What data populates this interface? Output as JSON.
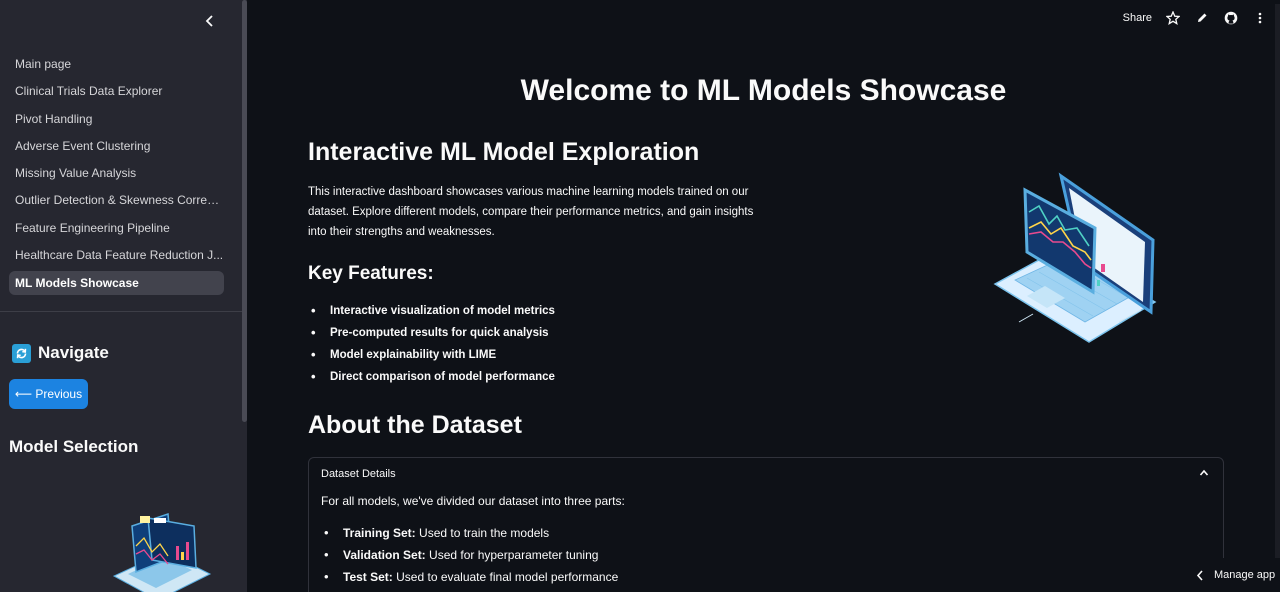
{
  "sidebar": {
    "collapse_icon": "chevron-left-icon",
    "items": [
      {
        "label": "Main page"
      },
      {
        "label": "Clinical Trials Data Explorer"
      },
      {
        "label": "Pivot Handling"
      },
      {
        "label": "Adverse Event Clustering"
      },
      {
        "label": "Missing Value Analysis"
      },
      {
        "label": "Outlier Detection & Skewness Correct..."
      },
      {
        "label": "Feature Engineering Pipeline"
      },
      {
        "label": "Healthcare Data Feature Reduction J..."
      },
      {
        "label": "ML Models Showcase",
        "active": true
      }
    ],
    "navigate_heading": "Navigate",
    "navigate_icon": "refresh-icon",
    "previous_button": "⟵ Previous",
    "model_selection_heading": "Model Selection"
  },
  "topbar": {
    "share_label": "Share",
    "icons": [
      "star-icon",
      "pencil-icon",
      "github-icon",
      "kebab-menu-icon"
    ]
  },
  "main": {
    "title": "Welcome to ML Models Showcase",
    "section1_heading": "Interactive ML Model Exploration",
    "intro_text": "This interactive dashboard showcases various machine learning models trained on our dataset. Explore different models, compare their performance metrics, and gain insights into their strengths and weaknesses.",
    "features_heading": "Key Features:",
    "features": [
      "Interactive visualization of model metrics",
      "Pre-computed results for quick analysis",
      "Model explainability with LIME",
      "Direct comparison of model performance"
    ],
    "dataset_heading": "About the Dataset",
    "expander": {
      "label": "Dataset Details",
      "intro": "For all models, we've divided our dataset into three parts:",
      "items": [
        {
          "term": "Training Set:",
          "desc": " Used to train the models"
        },
        {
          "term": "Validation Set:",
          "desc": " Used for hyperparameter tuning"
        },
        {
          "term": "Test Set:",
          "desc": " Used to evaluate final model performance"
        }
      ]
    }
  },
  "footer": {
    "manage_app": "Manage app"
  },
  "colors": {
    "background": "#0e1117",
    "sidebar": "#262730",
    "primary_button": "#1c83e1",
    "active_nav": "#42434d"
  }
}
